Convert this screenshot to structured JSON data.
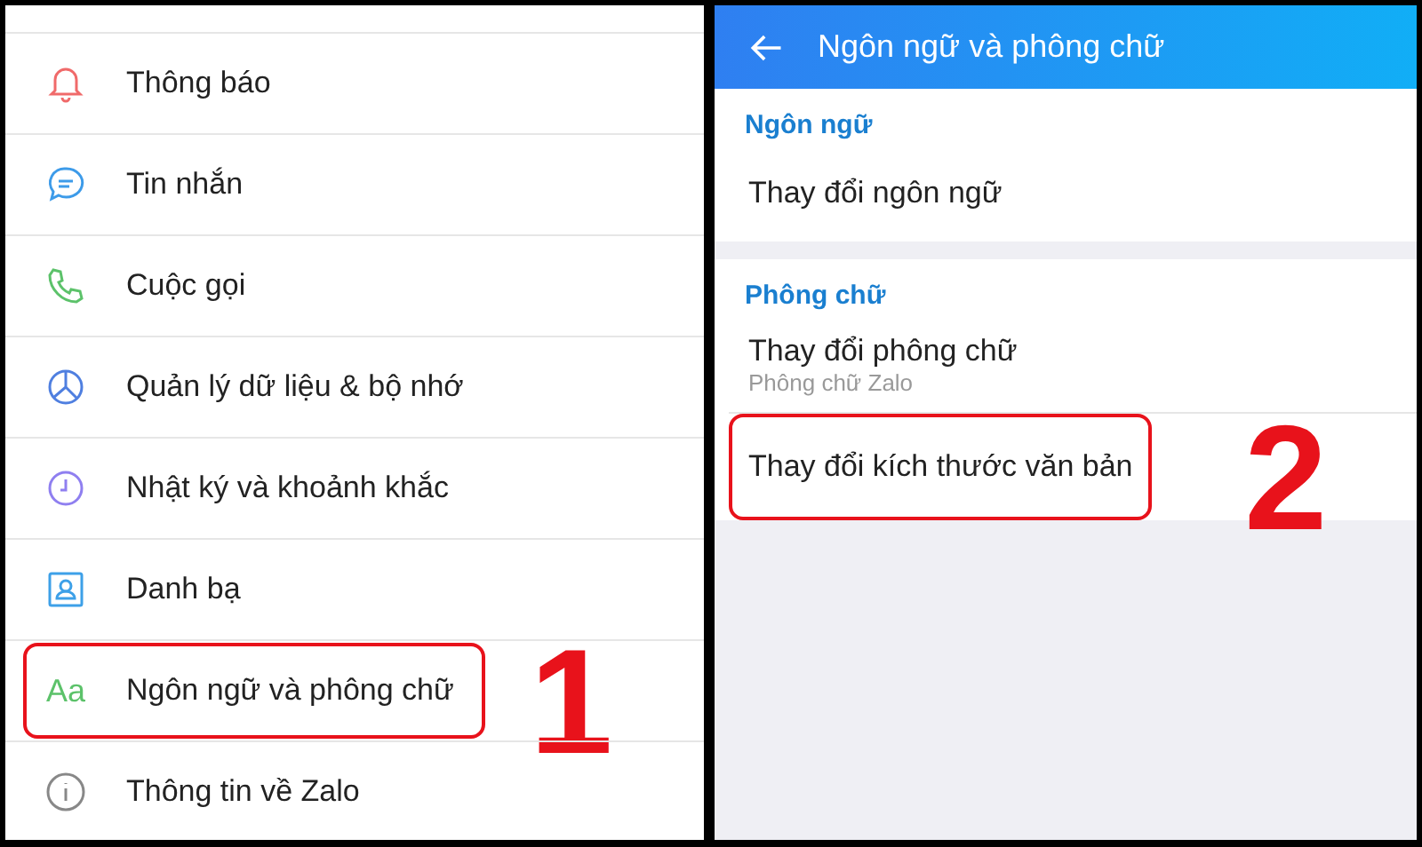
{
  "settings_screen": {
    "items": [
      {
        "label": "Thông báo",
        "highlighted": false
      },
      {
        "label": "Tin nhắn",
        "highlighted": false
      },
      {
        "label": "Cuộc gọi",
        "highlighted": false
      },
      {
        "label": "Quản lý dữ liệu & bộ nhớ",
        "highlighted": false
      },
      {
        "label": "Nhật ký và khoảnh khắc",
        "highlighted": false
      },
      {
        "label": "Danh bạ",
        "highlighted": false
      },
      {
        "label": "Ngôn ngữ và phông chữ",
        "icon_text": "Aa",
        "highlighted": true,
        "annotation": "1"
      },
      {
        "label": "Thông tin về Zalo",
        "highlighted": false
      }
    ]
  },
  "language_screen": {
    "header": {
      "title": "Ngôn ngữ và phông chữ"
    },
    "sections": [
      {
        "title": "Ngôn ngữ",
        "items": [
          {
            "label": "Thay đổi ngôn ngữ",
            "highlighted": false
          }
        ]
      },
      {
        "title": "Phông chữ",
        "items": [
          {
            "label": "Thay đổi phông chữ",
            "sublabel": "Phông chữ Zalo",
            "highlighted": false
          },
          {
            "label": "Thay đổi kích thước văn bản",
            "highlighted": true,
            "annotation": "2"
          }
        ]
      }
    ]
  }
}
